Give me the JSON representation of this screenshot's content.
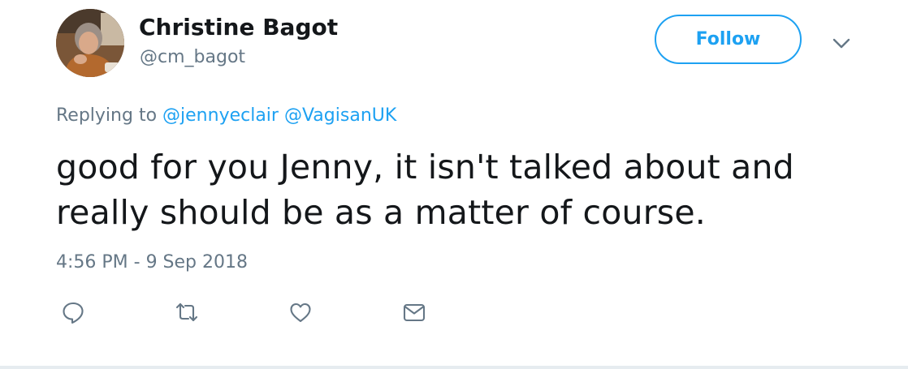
{
  "author": {
    "display_name": "Christine Bagot",
    "screen_name": "@cm_bagot"
  },
  "follow_button": {
    "label": "Follow"
  },
  "reply_context": {
    "prefix": "Replying to",
    "mentions": [
      "@jennyeclair",
      "@VagisanUK"
    ]
  },
  "tweet": {
    "text": "good for you Jenny, it isn't talked about and really should be as a matter of course.",
    "timestamp": "4:56 PM - 9 Sep 2018"
  },
  "actions": {
    "reply_icon": "speech-bubble-icon",
    "retweet_icon": "retweet-arrows-icon",
    "like_icon": "heart-icon",
    "dm_icon": "envelope-icon"
  },
  "colors": {
    "accent": "#1da1f2",
    "secondary_text": "#657786",
    "primary_text": "#14171a",
    "divider": "#e6ecf0"
  }
}
